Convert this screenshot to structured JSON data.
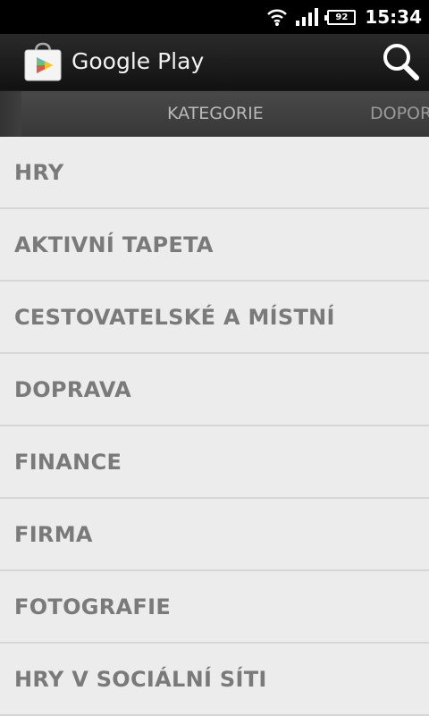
{
  "status_bar": {
    "battery": "92",
    "time": "15:34"
  },
  "action_bar": {
    "title": "Google Play"
  },
  "tabs": [
    {
      "label": "KATEGORIE"
    },
    {
      "label": "DOPOR"
    }
  ],
  "categories": [
    {
      "label": "HRY"
    },
    {
      "label": "AKTIVNÍ TAPETA"
    },
    {
      "label": "CESTOVATELSKÉ A MÍSTNÍ"
    },
    {
      "label": "DOPRAVA"
    },
    {
      "label": "FINANCE"
    },
    {
      "label": "FIRMA"
    },
    {
      "label": "FOTOGRAFIE"
    },
    {
      "label": "HRY V SOCIÁLNÍ SÍTI"
    }
  ]
}
